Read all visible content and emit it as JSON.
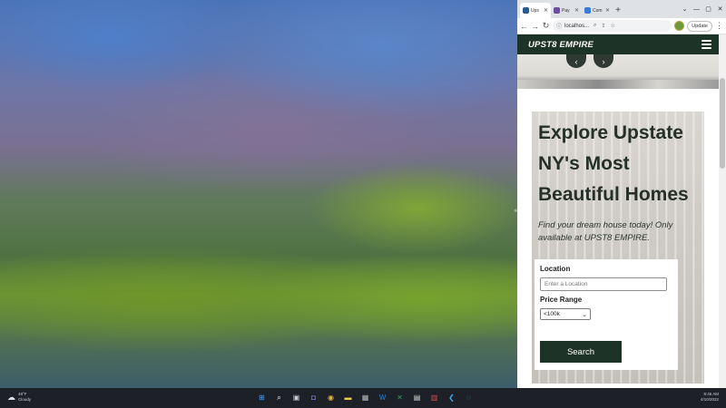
{
  "browser": {
    "tabs": [
      {
        "label": "Ups",
        "active": true
      },
      {
        "label": "Pay",
        "active": false
      },
      {
        "label": "Com",
        "active": false
      }
    ],
    "new_tab_symbol": "+",
    "window_controls": [
      "⌄",
      "—",
      "▢",
      "✕"
    ],
    "address": "localhos...",
    "update_label": "Update",
    "icons": [
      "back-icon",
      "forward-icon",
      "reload-icon",
      "info-icon",
      "zoom-icon",
      "share-icon",
      "star-icon",
      "profile-icon",
      "menu-icon"
    ]
  },
  "page": {
    "brand": "UPST8 EMPIRE",
    "carousel": {
      "prev_symbol": "‹",
      "next_symbol": "›"
    },
    "hero": {
      "title": "Explore Upstate NY's Most Beautiful Homes",
      "subtitle": "Find your dream house today! Only available at UPST8 EMPIRE."
    },
    "search_form": {
      "location_label": "Location",
      "location_placeholder": "Enter a Location",
      "price_label": "Price Range",
      "price_selected": "<100k",
      "submit_label": "Search"
    }
  },
  "taskbar": {
    "weather_temp": "48°F",
    "weather_desc": "Cloudy",
    "time": "8:46 AM",
    "date": "4/10/2022",
    "apps": [
      "windows-start-icon",
      "search-icon",
      "explorer-icon",
      "chat-icon",
      "chrome-icon",
      "photos-icon",
      "word-icon",
      "excel-icon",
      "app-icon",
      "app-icon",
      "vscode-icon",
      "app-icon"
    ]
  },
  "colors": {
    "brand_green": "#1e3327",
    "hero_text": "#253029",
    "taskbar_bg": "#1d2026"
  }
}
